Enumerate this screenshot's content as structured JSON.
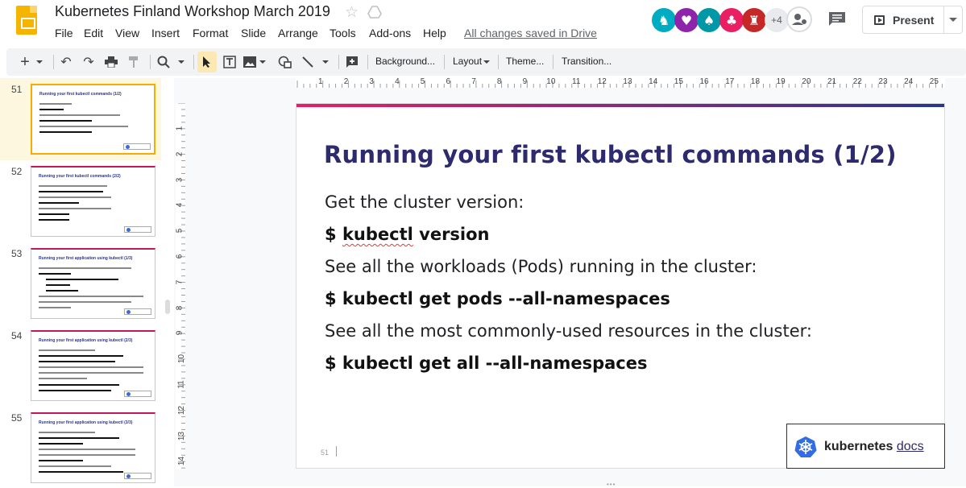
{
  "app": {
    "title": "Kubernetes Finland Workshop March 2019",
    "save_status": "All changes saved in Drive",
    "menu": [
      "File",
      "Edit",
      "View",
      "Insert",
      "Format",
      "Slide",
      "Arrange",
      "Tools",
      "Add-ons",
      "Help"
    ],
    "collaborators_more": "+4",
    "present_label": "Present"
  },
  "toolbar": {
    "background_label": "Background...",
    "layout_label": "Layout",
    "theme_label": "Theme...",
    "transition_label": "Transition..."
  },
  "ruler": {
    "horizontal": [
      "1",
      "2",
      "3",
      "4",
      "5",
      "6",
      "7",
      "8",
      "9",
      "10",
      "11",
      "12",
      "13",
      "14",
      "15",
      "16",
      "17",
      "18",
      "19",
      "20",
      "21",
      "22",
      "23",
      "24",
      "25"
    ],
    "vertical": [
      "1",
      "2",
      "3",
      "4",
      "5",
      "6",
      "7",
      "8",
      "9",
      "10",
      "11",
      "12",
      "13",
      "14"
    ]
  },
  "filmstrip": [
    {
      "num": "51",
      "title": "Running your first kubectl commands (1/2)",
      "active": true
    },
    {
      "num": "52",
      "title": "Running your first kubectl commands (2/2)",
      "active": false
    },
    {
      "num": "53",
      "title": "Running your first application using kubectl (1/3)",
      "active": false
    },
    {
      "num": "54",
      "title": "Running your first application using kubectl (2/3)",
      "active": false
    },
    {
      "num": "55",
      "title": "Running your first application using kubectl (3/3)",
      "active": false
    }
  ],
  "slide": {
    "title": "Running your first kubectl commands (1/2)",
    "lines": [
      {
        "text": "Get the cluster version:",
        "cmd": false
      },
      {
        "text": "$ kubectl version",
        "cmd": true
      },
      {
        "text": "See all the workloads (Pods) running in the cluster:",
        "cmd": false
      },
      {
        "text": "$ kubectl get pods --all-namespaces",
        "cmd": true
      },
      {
        "text": "See all the most commonly-used resources in the cluster:",
        "cmd": false
      },
      {
        "text": "$ kubectl get all --all-namespaces",
        "cmd": true
      }
    ],
    "number": "51",
    "badge_brand": "kubernetes",
    "badge_docs": "docs"
  },
  "colors": {
    "accent_title": "#2d2a6e",
    "slide_bar_start": "#e91e63",
    "slide_bar_end": "#283593",
    "active_thumb": "#f9ab00"
  }
}
